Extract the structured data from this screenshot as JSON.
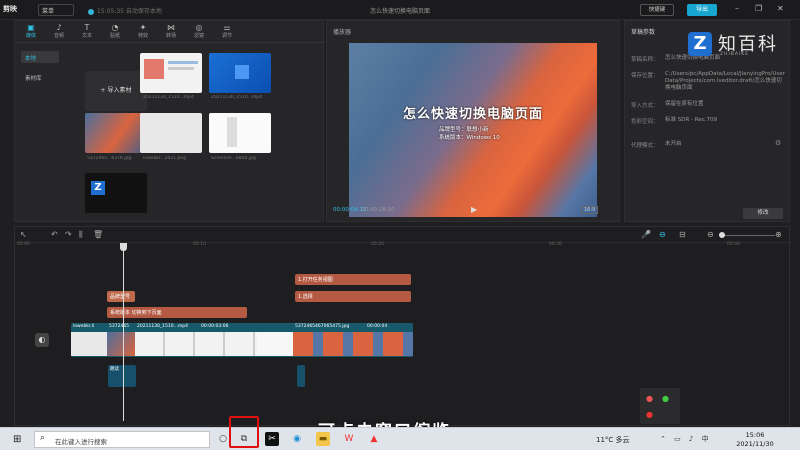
{
  "app": {
    "logo": "剪映",
    "menu": "菜单",
    "autosave": "15:05:35 自动保存本地",
    "doc_title": "怎么快速切换电脑页面",
    "shortcut": "快捷键",
    "export": "导出"
  },
  "tool_tabs": [
    {
      "label": "媒体",
      "icon": "▣"
    },
    {
      "label": "音频",
      "icon": "♪"
    },
    {
      "label": "文本",
      "icon": "T"
    },
    {
      "label": "贴纸",
      "icon": "◔"
    },
    {
      "label": "特效",
      "icon": "✦"
    },
    {
      "label": "转场",
      "icon": "⋈"
    },
    {
      "label": "滤镜",
      "icon": "◎"
    },
    {
      "label": "调节",
      "icon": "⚌"
    }
  ],
  "media_side": [
    "本地",
    "素材库"
  ],
  "media": {
    "import_label": "+ 导入素材",
    "clips": [
      "20211130_1510...mp4",
      "20211130_1510...mp4",
      "5372465...6376.jpg",
      "lowebkr...2021.png",
      "Screensh...6850.jpg",
      ""
    ]
  },
  "player": {
    "label": "播放器",
    "video_title": "怎么快速切换电脑页面",
    "sub1": "品牌型号：联想小新",
    "sub2": "系统版本：Windows 10",
    "time_current": "00:00:04:12",
    "time_total": "00:00:28:10",
    "ratio": "16:9"
  },
  "properties": {
    "title": "草稿参数",
    "rows": [
      {
        "k": "草稿名称：",
        "v": "怎么快速切换电脑页面"
      },
      {
        "k": "保存位置：",
        "v": "C:/Users/pc/AppData/Local/JianyingPro/User Data/Projects/com.lveditor.draft/怎么快速切换电脑页面"
      },
      {
        "k": "导入方式：",
        "v": "保留在原有位置"
      },
      {
        "k": "色彩空间：",
        "v": "标准 SDR - Rec.709"
      },
      {
        "k": "代理模式：",
        "v": "未开启"
      }
    ],
    "modify": "修改"
  },
  "watermark": {
    "logo": "Z",
    "text": "知百科",
    "sub": "ZHIBAIKE"
  },
  "timeline": {
    "ruler": [
      "00:00",
      "00:10",
      "00:20",
      "00:30",
      "00:40",
      "00:50"
    ],
    "text_bars": [
      "1.打开任务视图",
      "1.选择",
      "品牌型号",
      "系统版本 切换到下页面"
    ],
    "clips": [
      "lowebkr.li",
      "5372465",
      "20211130_1510...mp4",
      "00:00:03:06",
      "5372465467065475.jpg",
      "00:00:04"
    ],
    "audio": [
      "朗读"
    ]
  },
  "subtitle": "可点击窗口缩览",
  "taskbar": {
    "search_placeholder": "在此键入进行搜索",
    "weather": "11°C 多云",
    "time": "15:06",
    "date": "2021/11/30"
  }
}
